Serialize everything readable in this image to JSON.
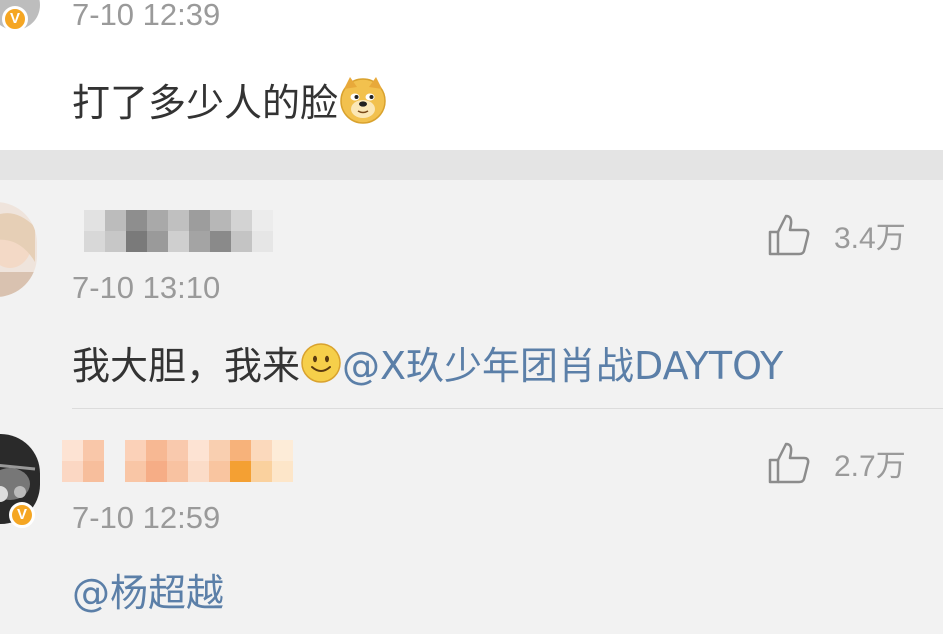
{
  "top_post": {
    "timestamp": "7-10 12:39",
    "text": "打了多少人的脸",
    "emoji": "doge-emoji",
    "verified_badge": "V"
  },
  "comments": [
    {
      "username_visible": false,
      "timestamp": "7-10 13:10",
      "likes": "3.4万",
      "text": "我大胆，我来",
      "emoji": "smile-emoji",
      "mention": "@X玖少年团肖战DAYTOY"
    },
    {
      "username_visible": false,
      "verified_badge": "V",
      "timestamp": "7-10 12:59",
      "likes": "2.7万",
      "mention": "@杨超越"
    }
  ],
  "colors": {
    "mention": "#5b7fa8",
    "text": "#333333",
    "meta": "#9a9a9a",
    "badge": "#f5a623"
  },
  "icons": [
    "thumbs-up-icon",
    "doge-emoji",
    "smile-emoji",
    "verified-badge-icon"
  ]
}
